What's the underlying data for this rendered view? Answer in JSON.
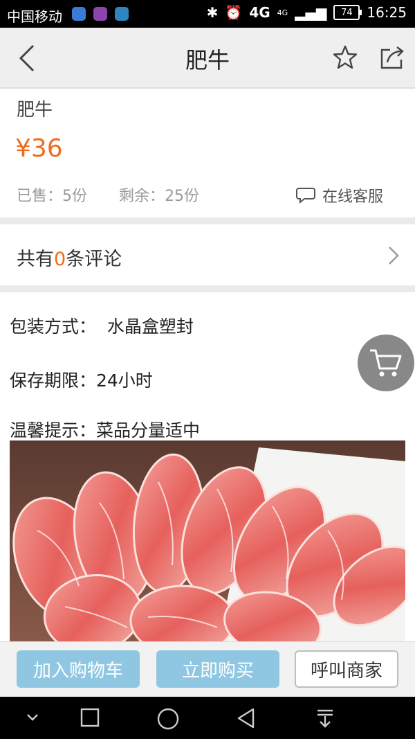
{
  "status_bar": {
    "carrier": "中国移动",
    "network": "4G",
    "network_small": "4G",
    "battery": "74",
    "time": "16:25",
    "app_icons": [
      "location-icon",
      "gallery-icon",
      "browser-icon"
    ]
  },
  "nav": {
    "title": "肥牛"
  },
  "product": {
    "name": "肥牛",
    "price": "¥36",
    "sold": "已售：5份",
    "remaining": "剩余：25份",
    "service_label": "在线客服"
  },
  "reviews": {
    "prefix": "共有",
    "count": "0",
    "suffix": "条评论"
  },
  "details": {
    "packaging": "包装方式：  水晶盒塑封",
    "shelf_life": "保存期限：24小时",
    "tip": "温馨提示：菜品分量适中"
  },
  "actions": {
    "add_to_cart": "加入购物车",
    "buy_now": "立即购买",
    "call_merchant": "呼叫商家"
  },
  "colors": {
    "accent": "#f26a1b",
    "button_blue": "#8fc7e2",
    "divider": "#eaeaea"
  }
}
